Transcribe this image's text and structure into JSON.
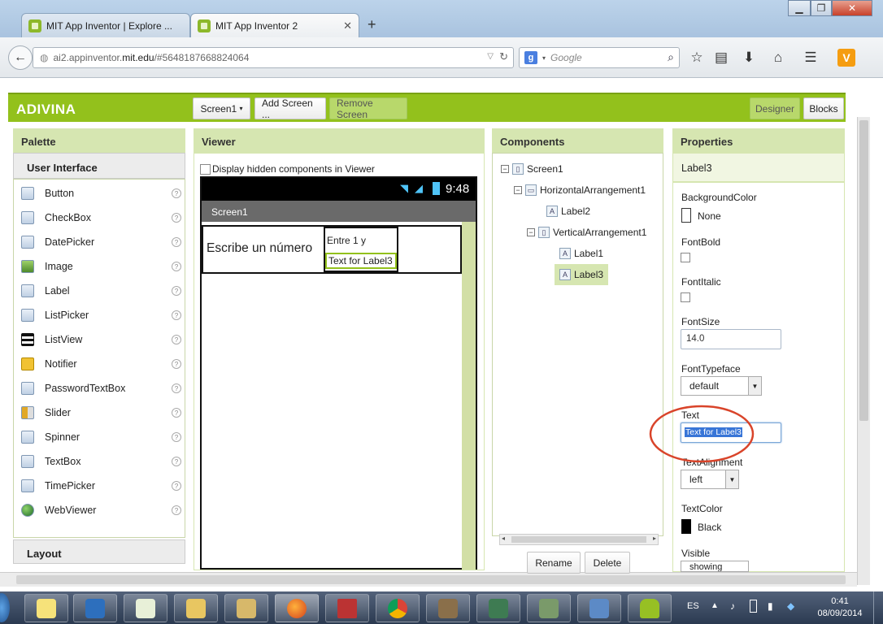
{
  "browser": {
    "tabs": [
      {
        "label": "MIT App Inventor | Explore ..."
      },
      {
        "label": "MIT App Inventor 2"
      }
    ],
    "new_tab": "+",
    "url_prefix": "ai2.appinventor.",
    "url_host": "mit.edu",
    "url_path": "/#5648187668824064",
    "search_placeholder": "Google",
    "window_controls": {
      "minimize": "▁",
      "restore": "❐",
      "close": "✕"
    }
  },
  "app": {
    "brand": "ADIVINA",
    "screen_select": "Screen1",
    "add_screen": "Add Screen ...",
    "remove_screen": "Remove Screen",
    "designer": "Designer",
    "blocks": "Blocks"
  },
  "palette": {
    "title": "Palette",
    "section": "User Interface",
    "items": [
      {
        "label": "Button",
        "icon": "button-icon"
      },
      {
        "label": "CheckBox",
        "icon": "checkbox-icon"
      },
      {
        "label": "DatePicker",
        "icon": "datepicker-icon"
      },
      {
        "label": "Image",
        "icon": "image-icon"
      },
      {
        "label": "Label",
        "icon": "label-icon"
      },
      {
        "label": "ListPicker",
        "icon": "listpicker-icon"
      },
      {
        "label": "ListView",
        "icon": "listview-icon"
      },
      {
        "label": "Notifier",
        "icon": "notifier-icon"
      },
      {
        "label": "PasswordTextBox",
        "icon": "passwordtextbox-icon"
      },
      {
        "label": "Slider",
        "icon": "slider-icon"
      },
      {
        "label": "Spinner",
        "icon": "spinner-icon"
      },
      {
        "label": "TextBox",
        "icon": "textbox-icon"
      },
      {
        "label": "TimePicker",
        "icon": "timepicker-icon"
      },
      {
        "label": "WebViewer",
        "icon": "webviewer-icon"
      }
    ],
    "help": "?",
    "layout_section": "Layout"
  },
  "viewer": {
    "title": "Viewer",
    "hidden_components": "Display hidden components in Viewer",
    "phone_time": "9:48",
    "screen_title": "Screen1",
    "label2": "Escribe un número",
    "label1": "Entre 1 y",
    "label3": "Text for Label3"
  },
  "components": {
    "title": "Components",
    "tree": [
      "Screen1",
      "HorizontalArrangement1",
      "Label2",
      "VerticalArrangement1",
      "Label1",
      "Label3"
    ],
    "rename": "Rename",
    "delete": "Delete"
  },
  "properties": {
    "title": "Properties",
    "component": "Label3",
    "background_color_label": "BackgroundColor",
    "background_color_value": "None",
    "font_bold_label": "FontBold",
    "font_italic_label": "FontItalic",
    "font_size_label": "FontSize",
    "font_size_value": "14.0",
    "font_typeface_label": "FontTypeface",
    "font_typeface_value": "default",
    "text_label": "Text",
    "text_value": "Text for Label3",
    "text_alignment_label": "TextAlignment",
    "text_alignment_value": "left",
    "text_color_label": "TextColor",
    "text_color_value": "Black",
    "visible_label": "Visible",
    "visible_value": "showing"
  },
  "taskbar": {
    "language": "ES",
    "time": "0:41",
    "date": "08/09/2014"
  },
  "colors": {
    "accent": "#93c11c",
    "annotation": "#d9442a"
  }
}
